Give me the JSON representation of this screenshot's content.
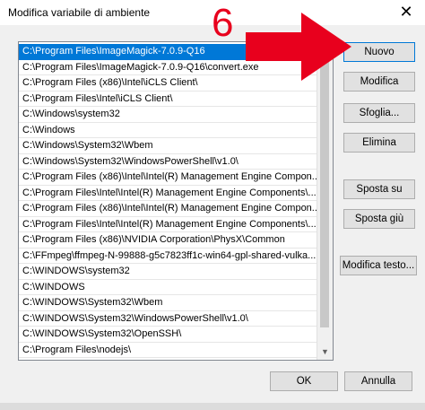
{
  "window": {
    "title": "Modifica variabile di ambiente",
    "close_glyph": "✕"
  },
  "annotation": {
    "step_number": "6",
    "color": "#e8001d"
  },
  "path_list": {
    "selected_index": 0,
    "items": [
      "C:\\Program Files\\ImageMagick-7.0.9-Q16",
      "C:\\Program Files\\ImageMagick-7.0.9-Q16\\convert.exe",
      "C:\\Program Files (x86)\\Intel\\iCLS Client\\",
      "C:\\Program Files\\Intel\\iCLS Client\\",
      "C:\\Windows\\system32",
      "C:\\Windows",
      "C:\\Windows\\System32\\Wbem",
      "C:\\Windows\\System32\\WindowsPowerShell\\v1.0\\",
      "C:\\Program Files (x86)\\Intel\\Intel(R) Management Engine Compon...",
      "C:\\Program Files\\Intel\\Intel(R) Management Engine Components\\...",
      "C:\\Program Files (x86)\\Intel\\Intel(R) Management Engine Compon...",
      "C:\\Program Files\\Intel\\Intel(R) Management Engine Components\\...",
      "C:\\Program Files (x86)\\NVIDIA Corporation\\PhysX\\Common",
      "C:\\FFmpeg\\ffmpeg-N-99888-g5c7823ff1c-win64-gpl-shared-vulka...",
      "C:\\WINDOWS\\system32",
      "C:\\WINDOWS",
      "C:\\WINDOWS\\System32\\Wbem",
      "C:\\WINDOWS\\System32\\WindowsPowerShell\\v1.0\\",
      "C:\\WINDOWS\\System32\\OpenSSH\\",
      "C:\\Program Files\\nodejs\\"
    ]
  },
  "buttons": {
    "new": "Nuovo",
    "edit": "Modifica",
    "browse": "Sfoglia...",
    "delete": "Elimina",
    "move_up": "Sposta su",
    "move_down": "Sposta giù",
    "edit_text": "Modifica testo...",
    "ok": "OK",
    "cancel": "Annulla"
  },
  "colors": {
    "selection": "#0078d7",
    "window_bg": "#f0f0f0"
  }
}
